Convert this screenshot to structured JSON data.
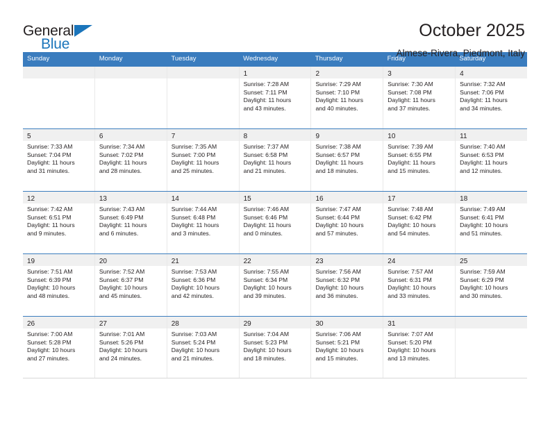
{
  "logo": {
    "word_top": "General",
    "word_bottom": "Blue",
    "triangle_color": "#1b75bb",
    "icon": "general-blue-logo"
  },
  "header": {
    "title": "October 2025",
    "subtitle": "Almese-Rivera, Piedmont, Italy"
  },
  "theme": {
    "header_blue": "#3a7cbe",
    "daynum_band": "#f0f0f0",
    "text": "#231f20"
  },
  "weekdays": [
    "Sunday",
    "Monday",
    "Tuesday",
    "Wednesday",
    "Thursday",
    "Friday",
    "Saturday"
  ],
  "weeks": [
    [
      {
        "day": "",
        "empty": true,
        "sunrise": "",
        "sunset": "",
        "daylight1": "",
        "daylight2": ""
      },
      {
        "day": "",
        "empty": true,
        "sunrise": "",
        "sunset": "",
        "daylight1": "",
        "daylight2": ""
      },
      {
        "day": "",
        "empty": true,
        "sunrise": "",
        "sunset": "",
        "daylight1": "",
        "daylight2": ""
      },
      {
        "day": "1",
        "empty": false,
        "sunrise": "Sunrise: 7:28 AM",
        "sunset": "Sunset: 7:11 PM",
        "daylight1": "Daylight: 11 hours",
        "daylight2": "and 43 minutes."
      },
      {
        "day": "2",
        "empty": false,
        "sunrise": "Sunrise: 7:29 AM",
        "sunset": "Sunset: 7:10 PM",
        "daylight1": "Daylight: 11 hours",
        "daylight2": "and 40 minutes."
      },
      {
        "day": "3",
        "empty": false,
        "sunrise": "Sunrise: 7:30 AM",
        "sunset": "Sunset: 7:08 PM",
        "daylight1": "Daylight: 11 hours",
        "daylight2": "and 37 minutes."
      },
      {
        "day": "4",
        "empty": false,
        "sunrise": "Sunrise: 7:32 AM",
        "sunset": "Sunset: 7:06 PM",
        "daylight1": "Daylight: 11 hours",
        "daylight2": "and 34 minutes."
      }
    ],
    [
      {
        "day": "5",
        "empty": false,
        "sunrise": "Sunrise: 7:33 AM",
        "sunset": "Sunset: 7:04 PM",
        "daylight1": "Daylight: 11 hours",
        "daylight2": "and 31 minutes."
      },
      {
        "day": "6",
        "empty": false,
        "sunrise": "Sunrise: 7:34 AM",
        "sunset": "Sunset: 7:02 PM",
        "daylight1": "Daylight: 11 hours",
        "daylight2": "and 28 minutes."
      },
      {
        "day": "7",
        "empty": false,
        "sunrise": "Sunrise: 7:35 AM",
        "sunset": "Sunset: 7:00 PM",
        "daylight1": "Daylight: 11 hours",
        "daylight2": "and 25 minutes."
      },
      {
        "day": "8",
        "empty": false,
        "sunrise": "Sunrise: 7:37 AM",
        "sunset": "Sunset: 6:58 PM",
        "daylight1": "Daylight: 11 hours",
        "daylight2": "and 21 minutes."
      },
      {
        "day": "9",
        "empty": false,
        "sunrise": "Sunrise: 7:38 AM",
        "sunset": "Sunset: 6:57 PM",
        "daylight1": "Daylight: 11 hours",
        "daylight2": "and 18 minutes."
      },
      {
        "day": "10",
        "empty": false,
        "sunrise": "Sunrise: 7:39 AM",
        "sunset": "Sunset: 6:55 PM",
        "daylight1": "Daylight: 11 hours",
        "daylight2": "and 15 minutes."
      },
      {
        "day": "11",
        "empty": false,
        "sunrise": "Sunrise: 7:40 AM",
        "sunset": "Sunset: 6:53 PM",
        "daylight1": "Daylight: 11 hours",
        "daylight2": "and 12 minutes."
      }
    ],
    [
      {
        "day": "12",
        "empty": false,
        "sunrise": "Sunrise: 7:42 AM",
        "sunset": "Sunset: 6:51 PM",
        "daylight1": "Daylight: 11 hours",
        "daylight2": "and 9 minutes."
      },
      {
        "day": "13",
        "empty": false,
        "sunrise": "Sunrise: 7:43 AM",
        "sunset": "Sunset: 6:49 PM",
        "daylight1": "Daylight: 11 hours",
        "daylight2": "and 6 minutes."
      },
      {
        "day": "14",
        "empty": false,
        "sunrise": "Sunrise: 7:44 AM",
        "sunset": "Sunset: 6:48 PM",
        "daylight1": "Daylight: 11 hours",
        "daylight2": "and 3 minutes."
      },
      {
        "day": "15",
        "empty": false,
        "sunrise": "Sunrise: 7:46 AM",
        "sunset": "Sunset: 6:46 PM",
        "daylight1": "Daylight: 11 hours",
        "daylight2": "and 0 minutes."
      },
      {
        "day": "16",
        "empty": false,
        "sunrise": "Sunrise: 7:47 AM",
        "sunset": "Sunset: 6:44 PM",
        "daylight1": "Daylight: 10 hours",
        "daylight2": "and 57 minutes."
      },
      {
        "day": "17",
        "empty": false,
        "sunrise": "Sunrise: 7:48 AM",
        "sunset": "Sunset: 6:42 PM",
        "daylight1": "Daylight: 10 hours",
        "daylight2": "and 54 minutes."
      },
      {
        "day": "18",
        "empty": false,
        "sunrise": "Sunrise: 7:49 AM",
        "sunset": "Sunset: 6:41 PM",
        "daylight1": "Daylight: 10 hours",
        "daylight2": "and 51 minutes."
      }
    ],
    [
      {
        "day": "19",
        "empty": false,
        "sunrise": "Sunrise: 7:51 AM",
        "sunset": "Sunset: 6:39 PM",
        "daylight1": "Daylight: 10 hours",
        "daylight2": "and 48 minutes."
      },
      {
        "day": "20",
        "empty": false,
        "sunrise": "Sunrise: 7:52 AM",
        "sunset": "Sunset: 6:37 PM",
        "daylight1": "Daylight: 10 hours",
        "daylight2": "and 45 minutes."
      },
      {
        "day": "21",
        "empty": false,
        "sunrise": "Sunrise: 7:53 AM",
        "sunset": "Sunset: 6:36 PM",
        "daylight1": "Daylight: 10 hours",
        "daylight2": "and 42 minutes."
      },
      {
        "day": "22",
        "empty": false,
        "sunrise": "Sunrise: 7:55 AM",
        "sunset": "Sunset: 6:34 PM",
        "daylight1": "Daylight: 10 hours",
        "daylight2": "and 39 minutes."
      },
      {
        "day": "23",
        "empty": false,
        "sunrise": "Sunrise: 7:56 AM",
        "sunset": "Sunset: 6:32 PM",
        "daylight1": "Daylight: 10 hours",
        "daylight2": "and 36 minutes."
      },
      {
        "day": "24",
        "empty": false,
        "sunrise": "Sunrise: 7:57 AM",
        "sunset": "Sunset: 6:31 PM",
        "daylight1": "Daylight: 10 hours",
        "daylight2": "and 33 minutes."
      },
      {
        "day": "25",
        "empty": false,
        "sunrise": "Sunrise: 7:59 AM",
        "sunset": "Sunset: 6:29 PM",
        "daylight1": "Daylight: 10 hours",
        "daylight2": "and 30 minutes."
      }
    ],
    [
      {
        "day": "26",
        "empty": false,
        "sunrise": "Sunrise: 7:00 AM",
        "sunset": "Sunset: 5:28 PM",
        "daylight1": "Daylight: 10 hours",
        "daylight2": "and 27 minutes."
      },
      {
        "day": "27",
        "empty": false,
        "sunrise": "Sunrise: 7:01 AM",
        "sunset": "Sunset: 5:26 PM",
        "daylight1": "Daylight: 10 hours",
        "daylight2": "and 24 minutes."
      },
      {
        "day": "28",
        "empty": false,
        "sunrise": "Sunrise: 7:03 AM",
        "sunset": "Sunset: 5:24 PM",
        "daylight1": "Daylight: 10 hours",
        "daylight2": "and 21 minutes."
      },
      {
        "day": "29",
        "empty": false,
        "sunrise": "Sunrise: 7:04 AM",
        "sunset": "Sunset: 5:23 PM",
        "daylight1": "Daylight: 10 hours",
        "daylight2": "and 18 minutes."
      },
      {
        "day": "30",
        "empty": false,
        "sunrise": "Sunrise: 7:06 AM",
        "sunset": "Sunset: 5:21 PM",
        "daylight1": "Daylight: 10 hours",
        "daylight2": "and 15 minutes."
      },
      {
        "day": "31",
        "empty": false,
        "sunrise": "Sunrise: 7:07 AM",
        "sunset": "Sunset: 5:20 PM",
        "daylight1": "Daylight: 10 hours",
        "daylight2": "and 13 minutes."
      },
      {
        "day": "",
        "empty": true,
        "sunrise": "",
        "sunset": "",
        "daylight1": "",
        "daylight2": ""
      }
    ]
  ]
}
